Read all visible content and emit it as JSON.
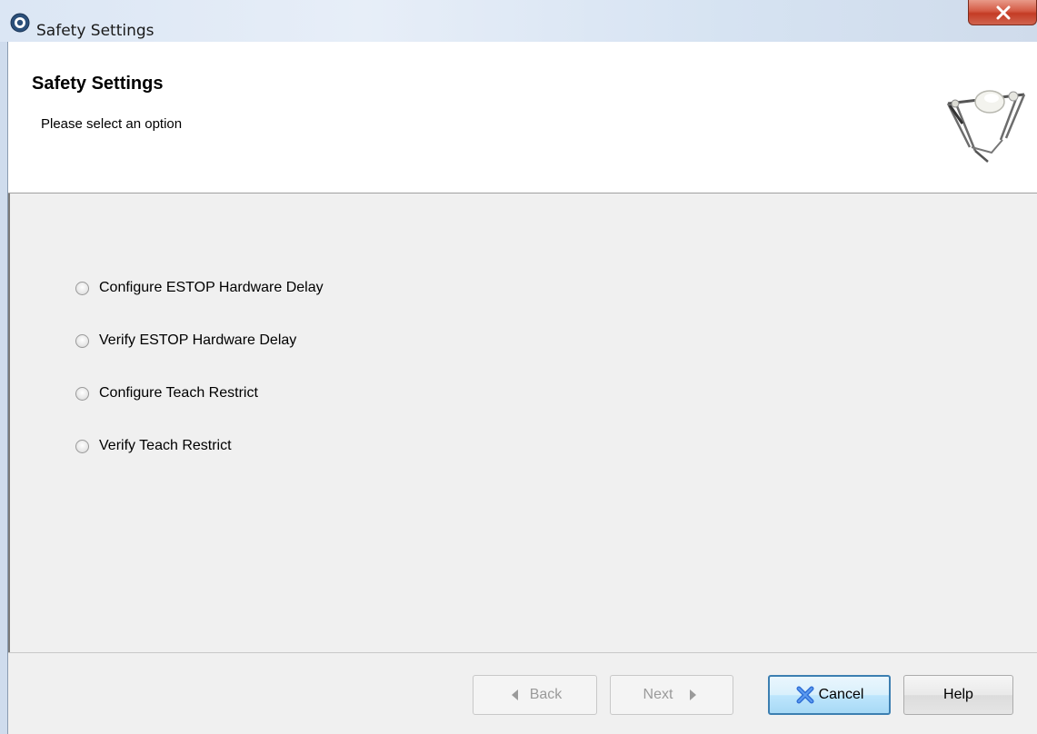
{
  "window": {
    "title": "Safety Settings",
    "icons": {
      "app": "app-icon",
      "close": "close-icon"
    }
  },
  "header": {
    "title": "Safety Settings",
    "subtitle": "Please select an option",
    "logo": "delta-robot-logo"
  },
  "options": [
    {
      "label": "Configure ESTOP Hardware Delay",
      "selected": false
    },
    {
      "label": "Verify ESTOP Hardware Delay",
      "selected": false
    },
    {
      "label": "Configure Teach Restrict",
      "selected": false
    },
    {
      "label": "Verify Teach Restrict",
      "selected": false
    }
  ],
  "buttons": {
    "back": {
      "label": "Back",
      "enabled": false,
      "icon": "back-arrow-icon"
    },
    "next": {
      "label": "Next",
      "enabled": false,
      "icon": "next-arrow-icon"
    },
    "cancel": {
      "label": "Cancel",
      "enabled": true,
      "icon": "cancel-x-icon"
    },
    "help": {
      "label": "Help",
      "enabled": true
    }
  },
  "colors": {
    "close_button": "#c43c25",
    "cancel_icon": "#2f6fd6",
    "default_button_border": "#3c7fb1"
  }
}
